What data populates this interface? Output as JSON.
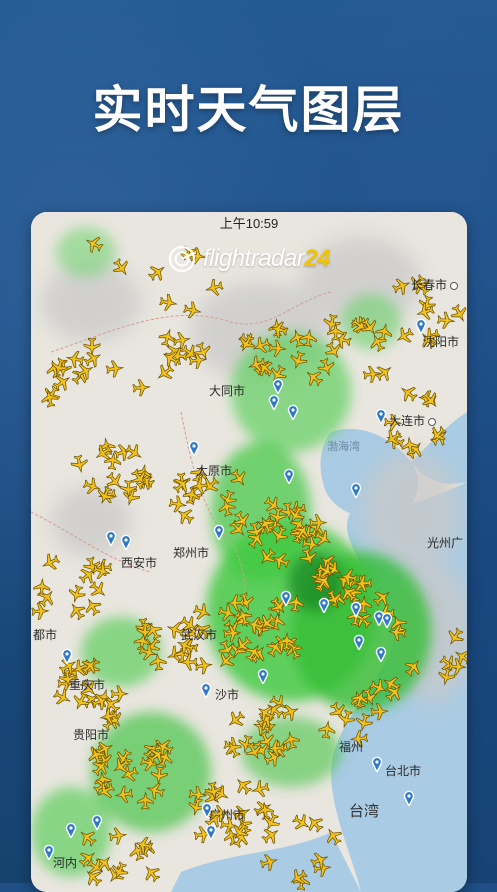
{
  "headline": "实时天气图层",
  "status_bar": {
    "time": "上午10:59"
  },
  "app": {
    "logo_text": "flightradar",
    "logo_number": "24"
  },
  "map": {
    "cities": [
      {
        "name": "长春市",
        "dot": true
      },
      {
        "name": "沈阳市",
        "dot": false
      },
      {
        "name": "大同市",
        "dot": false
      },
      {
        "name": "大连市",
        "dot": true
      },
      {
        "name": "渤海湾",
        "dot": false
      },
      {
        "name": "太原市",
        "dot": false
      },
      {
        "name": "郑州市",
        "dot": false
      },
      {
        "name": "西安市",
        "dot": false
      },
      {
        "name": "武汉市",
        "dot": false
      },
      {
        "name": "都市",
        "dot": false
      },
      {
        "name": "重庆市",
        "dot": false
      },
      {
        "name": "贵阳市",
        "dot": false
      },
      {
        "name": "福州",
        "dot": false
      },
      {
        "name": "台北市",
        "dot": false
      },
      {
        "name": "台湾",
        "dot": false
      },
      {
        "name": "广州市",
        "dot": false
      },
      {
        "name": "河内",
        "dot": false
      },
      {
        "name": "光州广",
        "dot": false
      },
      {
        "name": "沙市",
        "dot": false
      }
    ]
  },
  "colors": {
    "weather_green": "#3cc83c",
    "plane_yellow": "#f2c21b",
    "sea": "#a9cbe3",
    "land": "#e9e6df"
  }
}
